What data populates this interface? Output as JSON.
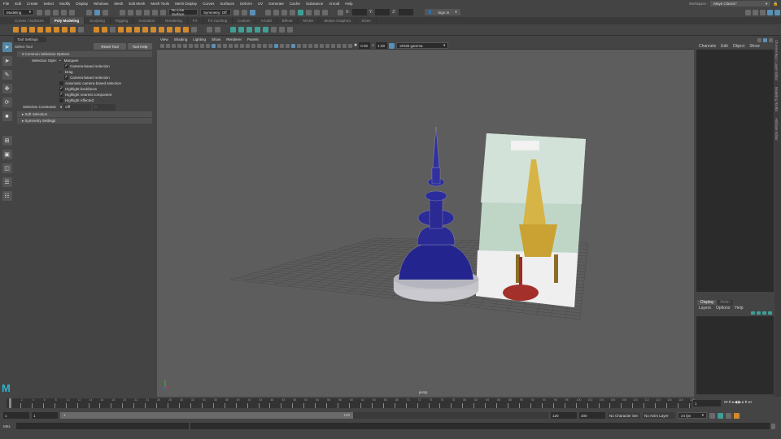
{
  "menubar": [
    "File",
    "Edit",
    "Create",
    "Select",
    "Modify",
    "Display",
    "Windows",
    "Mesh",
    "Edit Mesh",
    "Mesh Tools",
    "Mesh Display",
    "Curves",
    "Surfaces",
    "Deform",
    "UV",
    "Generate",
    "Cache",
    "Substance",
    "Arnold",
    "Help"
  ],
  "status": {
    "mode": "Modeling",
    "live_surface": "No Live Surface",
    "symmetry": "Symmetry: Off",
    "x_label": "X:",
    "y_label": "Y:",
    "z_label": "Z:",
    "sign_in": "Sign In",
    "workspace_label": "Workspace :",
    "workspace": "Maya Classic*"
  },
  "shelf_tabs": [
    "Curves / Surfaces",
    "Poly Modeling",
    "Sculpting",
    "Rigging",
    "Animation",
    "Rendering",
    "FX",
    "FX Caching",
    "Custom",
    "Arnold",
    "Bifrost",
    "MASH",
    "Motion Graphics",
    "XGen"
  ],
  "shelf_active": "Poly Modeling",
  "tool_settings": {
    "tab": "Tool Settings",
    "tool_name": "Select Tool",
    "reset": "Reset Tool",
    "help": "Tool Help",
    "common_section": "Common Selection Options",
    "style_label": "Selection Style:",
    "marquee": "Marquee",
    "camera_based": "Camera-based selection",
    "drag": "Drag",
    "camera_based2": "Camera-based selection",
    "auto_camera": "Automatic camera-based selection",
    "highlight_backfaces": "Highlight backfaces",
    "highlight_nearest": "Highlight nearest component",
    "highlight_affected": "Highlight Affected",
    "constraint_label": "Selection Constraint:",
    "constraint_value": "Off",
    "constraint_num": "0",
    "soft_selection": "Soft Selection",
    "symmetry_settings": "Symmetry Settings"
  },
  "viewport": {
    "menus": [
      "View",
      "Shading",
      "Lighting",
      "Show",
      "Renderer",
      "Panels"
    ],
    "exposure": "0.00",
    "gamma": "1.00",
    "color_space": "sRGB gamma",
    "camera": "persp"
  },
  "channel_box": {
    "menus": [
      "Channels",
      "Edit",
      "Object",
      "Show"
    ],
    "layer_tabs": [
      "Display",
      "Anim"
    ],
    "layer_menus": [
      "Layers",
      "Options",
      "Help"
    ]
  },
  "side_tabs": [
    "Channel Box / Layer Editor",
    "Modeling Toolkit",
    "Attribute Editor"
  ],
  "timeline": {
    "ticks": [
      "1",
      "2",
      "4",
      "6",
      "8",
      "10",
      "12",
      "14",
      "16",
      "18",
      "20",
      "22",
      "24",
      "26",
      "28",
      "30",
      "32",
      "34",
      "36",
      "38",
      "40",
      "42",
      "44",
      "46",
      "48",
      "50",
      "52",
      "54",
      "56",
      "58",
      "60",
      "62",
      "64",
      "66",
      "68",
      "70",
      "72",
      "74",
      "76",
      "78",
      "80",
      "82",
      "84",
      "86",
      "88",
      "90",
      "92",
      "94",
      "96",
      "98",
      "100",
      "102",
      "104",
      "106",
      "108",
      "110",
      "112",
      "114",
      "116",
      "118",
      "120"
    ],
    "current": "1"
  },
  "range": {
    "start": "1",
    "playback_start": "1",
    "slider_start": "1",
    "slider_end": "120",
    "playback_end": "120",
    "end": "200",
    "character_set": "No Character Set",
    "anim_layer": "No Anim Layer",
    "fps": "24 fps"
  },
  "command": {
    "lang": "MEL"
  },
  "colors": {
    "accent": "#5285a6",
    "viewport_bg": "#5d5d5d",
    "wireframe": "#1a1a8a"
  }
}
